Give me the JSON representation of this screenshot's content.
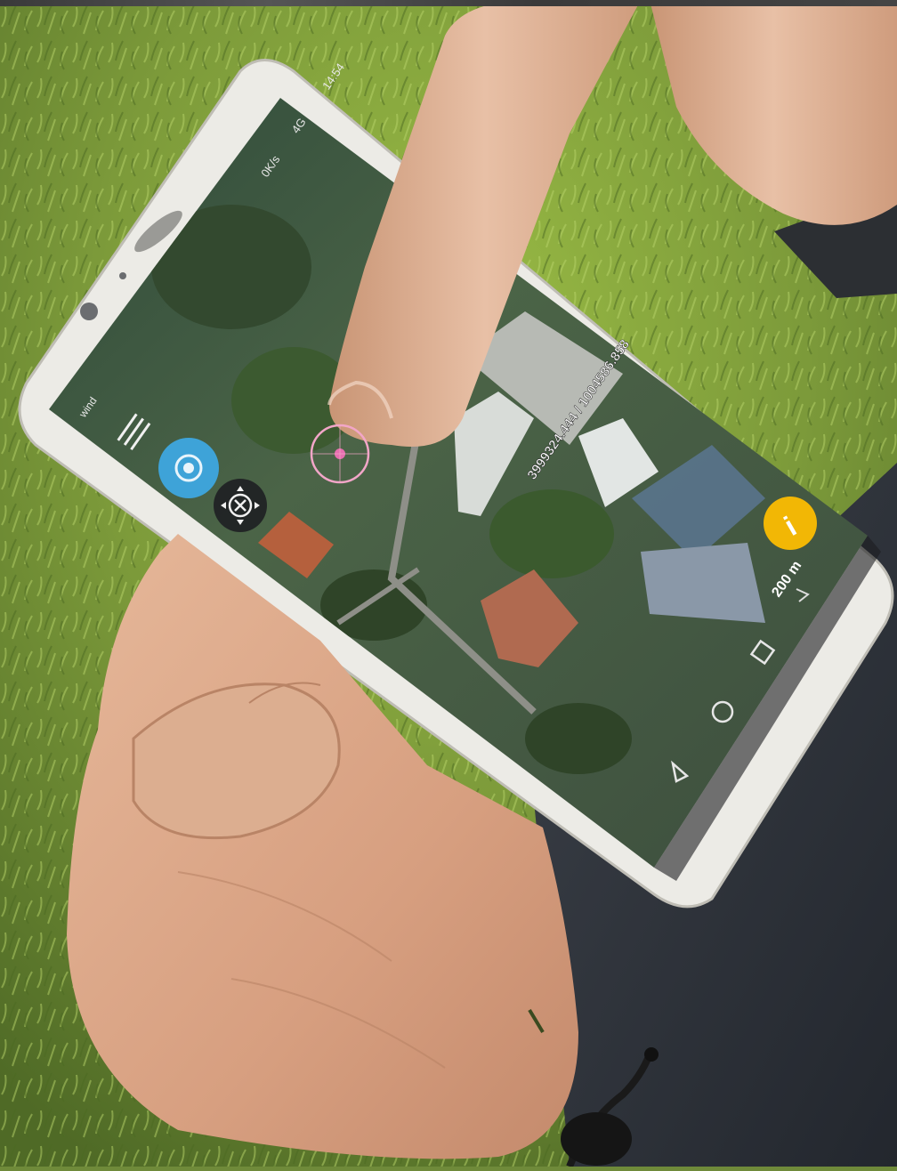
{
  "photo": {
    "subject": "phone-with-satellite-map"
  },
  "status_bar": {
    "time": "14:54",
    "speed": "0K/s",
    "signal": "4G",
    "carrier": "wind"
  },
  "map": {
    "coordinates": "3999324.444 / 1004586.858",
    "scale_label": "200 m",
    "info_button_label": "i"
  },
  "icons": {
    "menu": "hamburger-menu-icon",
    "locate": "gps-target-icon",
    "move": "move-crosshair-icon",
    "info": "info-icon",
    "nav_back": "back-triangle-icon",
    "nav_home": "home-circle-icon",
    "nav_recent": "recent-square-icon"
  },
  "colors": {
    "locate_button": "#3ea3d8",
    "info_button": "#f2b705",
    "marker": "#e86fb0",
    "grass": "#7c9a3a",
    "phone_frame": "#ecebe6"
  }
}
